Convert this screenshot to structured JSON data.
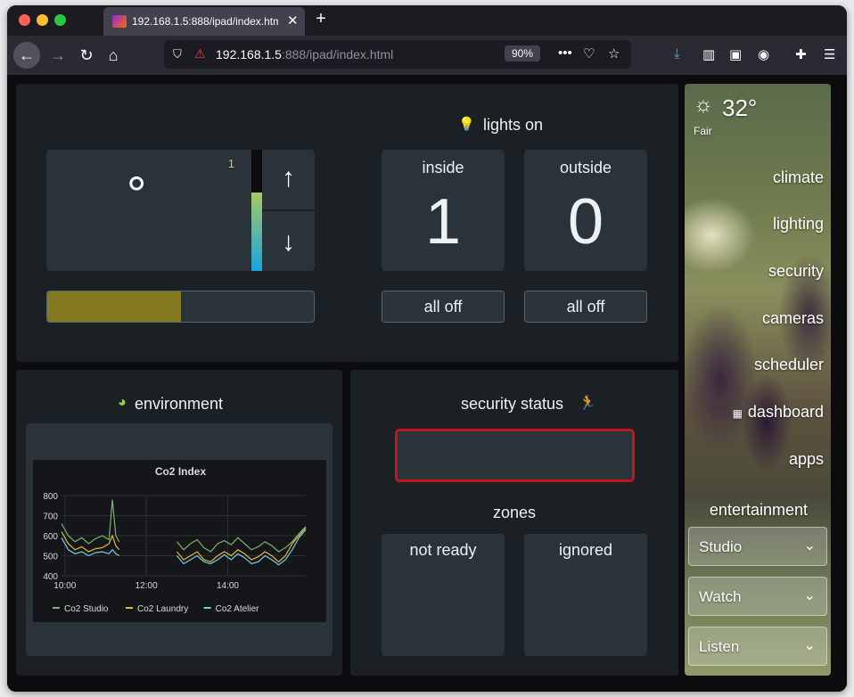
{
  "browser": {
    "tab_title": "192.168.1.5:888/ipad/index.htm",
    "url_host": "192.168.1.5",
    "url_rest": ":888/ipad/index.html",
    "zoom": "90%"
  },
  "climate": {
    "setpoint": "°",
    "mode_value": "1",
    "level_fraction": 0.65,
    "progress_fraction": 0.5
  },
  "lights": {
    "title": "lights on",
    "inside_label": "inside",
    "inside_value": "1",
    "outside_label": "outside",
    "outside_value": "0",
    "inside_off": "all off",
    "outside_off": "all off"
  },
  "environment": {
    "title": "environment"
  },
  "chart_data": {
    "type": "line",
    "title": "Co2 Index",
    "x_ticks": [
      "10:00",
      "12:00",
      "14:00"
    ],
    "y_ticks": [
      "800",
      "700",
      "600",
      "500",
      "400"
    ],
    "ylim": [
      400,
      800
    ],
    "xlim": [
      "09:55",
      "15:55"
    ],
    "legend_position": "bottom",
    "series": [
      {
        "name": "Co2 Studio",
        "color": "#7eb26d",
        "points": [
          [
            "09:55",
            660
          ],
          [
            "10:05",
            600
          ],
          [
            "10:15",
            570
          ],
          [
            "10:25",
            590
          ],
          [
            "10:35",
            560
          ],
          [
            "10:45",
            585
          ],
          [
            "10:55",
            600
          ],
          [
            "11:05",
            580
          ],
          [
            "11:10",
            780
          ],
          [
            "11:15",
            600
          ],
          [
            "11:20",
            570
          ],
          [
            "12:45",
            570
          ],
          [
            "12:55",
            530
          ],
          [
            "13:05",
            560
          ],
          [
            "13:15",
            580
          ],
          [
            "13:25",
            540
          ],
          [
            "13:35",
            520
          ],
          [
            "13:45",
            560
          ],
          [
            "13:55",
            575
          ],
          [
            "14:05",
            555
          ],
          [
            "14:15",
            590
          ],
          [
            "14:25",
            560
          ],
          [
            "14:35",
            530
          ],
          [
            "14:45",
            545
          ],
          [
            "14:55",
            570
          ],
          [
            "15:05",
            550
          ],
          [
            "15:15",
            520
          ],
          [
            "15:25",
            540
          ],
          [
            "15:35",
            570
          ],
          [
            "15:45",
            610
          ],
          [
            "15:55",
            645
          ]
        ]
      },
      {
        "name": "Co2 Laundry",
        "color": "#eab839",
        "points": [
          [
            "09:55",
            620
          ],
          [
            "10:05",
            560
          ],
          [
            "10:15",
            530
          ],
          [
            "10:25",
            545
          ],
          [
            "10:35",
            520
          ],
          [
            "10:45",
            535
          ],
          [
            "10:55",
            540
          ],
          [
            "11:05",
            560
          ],
          [
            "11:10",
            600
          ],
          [
            "11:15",
            550
          ],
          [
            "11:20",
            530
          ],
          [
            "12:45",
            520
          ],
          [
            "12:55",
            480
          ],
          [
            "13:05",
            500
          ],
          [
            "13:15",
            520
          ],
          [
            "13:25",
            480
          ],
          [
            "13:35",
            470
          ],
          [
            "13:45",
            500
          ],
          [
            "13:55",
            520
          ],
          [
            "14:05",
            500
          ],
          [
            "14:15",
            530
          ],
          [
            "14:25",
            510
          ],
          [
            "14:35",
            480
          ],
          [
            "14:45",
            495
          ],
          [
            "14:55",
            520
          ],
          [
            "15:05",
            500
          ],
          [
            "15:15",
            470
          ],
          [
            "15:25",
            500
          ],
          [
            "15:35",
            560
          ],
          [
            "15:45",
            600
          ],
          [
            "15:55",
            640
          ]
        ]
      },
      {
        "name": "Co2 Atelier",
        "color": "#6ed0e0",
        "points": [
          [
            "09:55",
            590
          ],
          [
            "10:05",
            530
          ],
          [
            "10:15",
            510
          ],
          [
            "10:25",
            520
          ],
          [
            "10:35",
            500
          ],
          [
            "10:45",
            515
          ],
          [
            "10:55",
            520
          ],
          [
            "11:05",
            510
          ],
          [
            "11:10",
            530
          ],
          [
            "11:15",
            510
          ],
          [
            "11:20",
            500
          ],
          [
            "12:45",
            500
          ],
          [
            "12:55",
            460
          ],
          [
            "13:05",
            480
          ],
          [
            "13:15",
            500
          ],
          [
            "13:25",
            470
          ],
          [
            "13:35",
            460
          ],
          [
            "13:45",
            480
          ],
          [
            "13:55",
            505
          ],
          [
            "14:05",
            480
          ],
          [
            "14:15",
            510
          ],
          [
            "14:25",
            490
          ],
          [
            "14:35",
            460
          ],
          [
            "14:45",
            470
          ],
          [
            "14:55",
            500
          ],
          [
            "15:05",
            480
          ],
          [
            "15:15",
            455
          ],
          [
            "15:25",
            480
          ],
          [
            "15:35",
            530
          ],
          [
            "15:45",
            590
          ],
          [
            "15:55",
            630
          ]
        ]
      }
    ]
  },
  "security": {
    "title": "security status",
    "zones_title": "zones",
    "not_ready": "not ready",
    "ignored": "ignored"
  },
  "weather": {
    "temp": "32°",
    "condition": "Fair"
  },
  "sidebar": {
    "items": [
      "climate",
      "lighting",
      "security",
      "cameras",
      "scheduler",
      "dashboard",
      "apps",
      "entertainment"
    ],
    "dropdowns": [
      "Studio",
      "Watch",
      "Listen"
    ]
  },
  "colors": {
    "panel": "#1b2025",
    "tile": "#2b333a",
    "progress": "#837a1f",
    "alert_border": "#c4151c",
    "lights_icon": "#9ad23b",
    "security_icon": "#d12020"
  }
}
